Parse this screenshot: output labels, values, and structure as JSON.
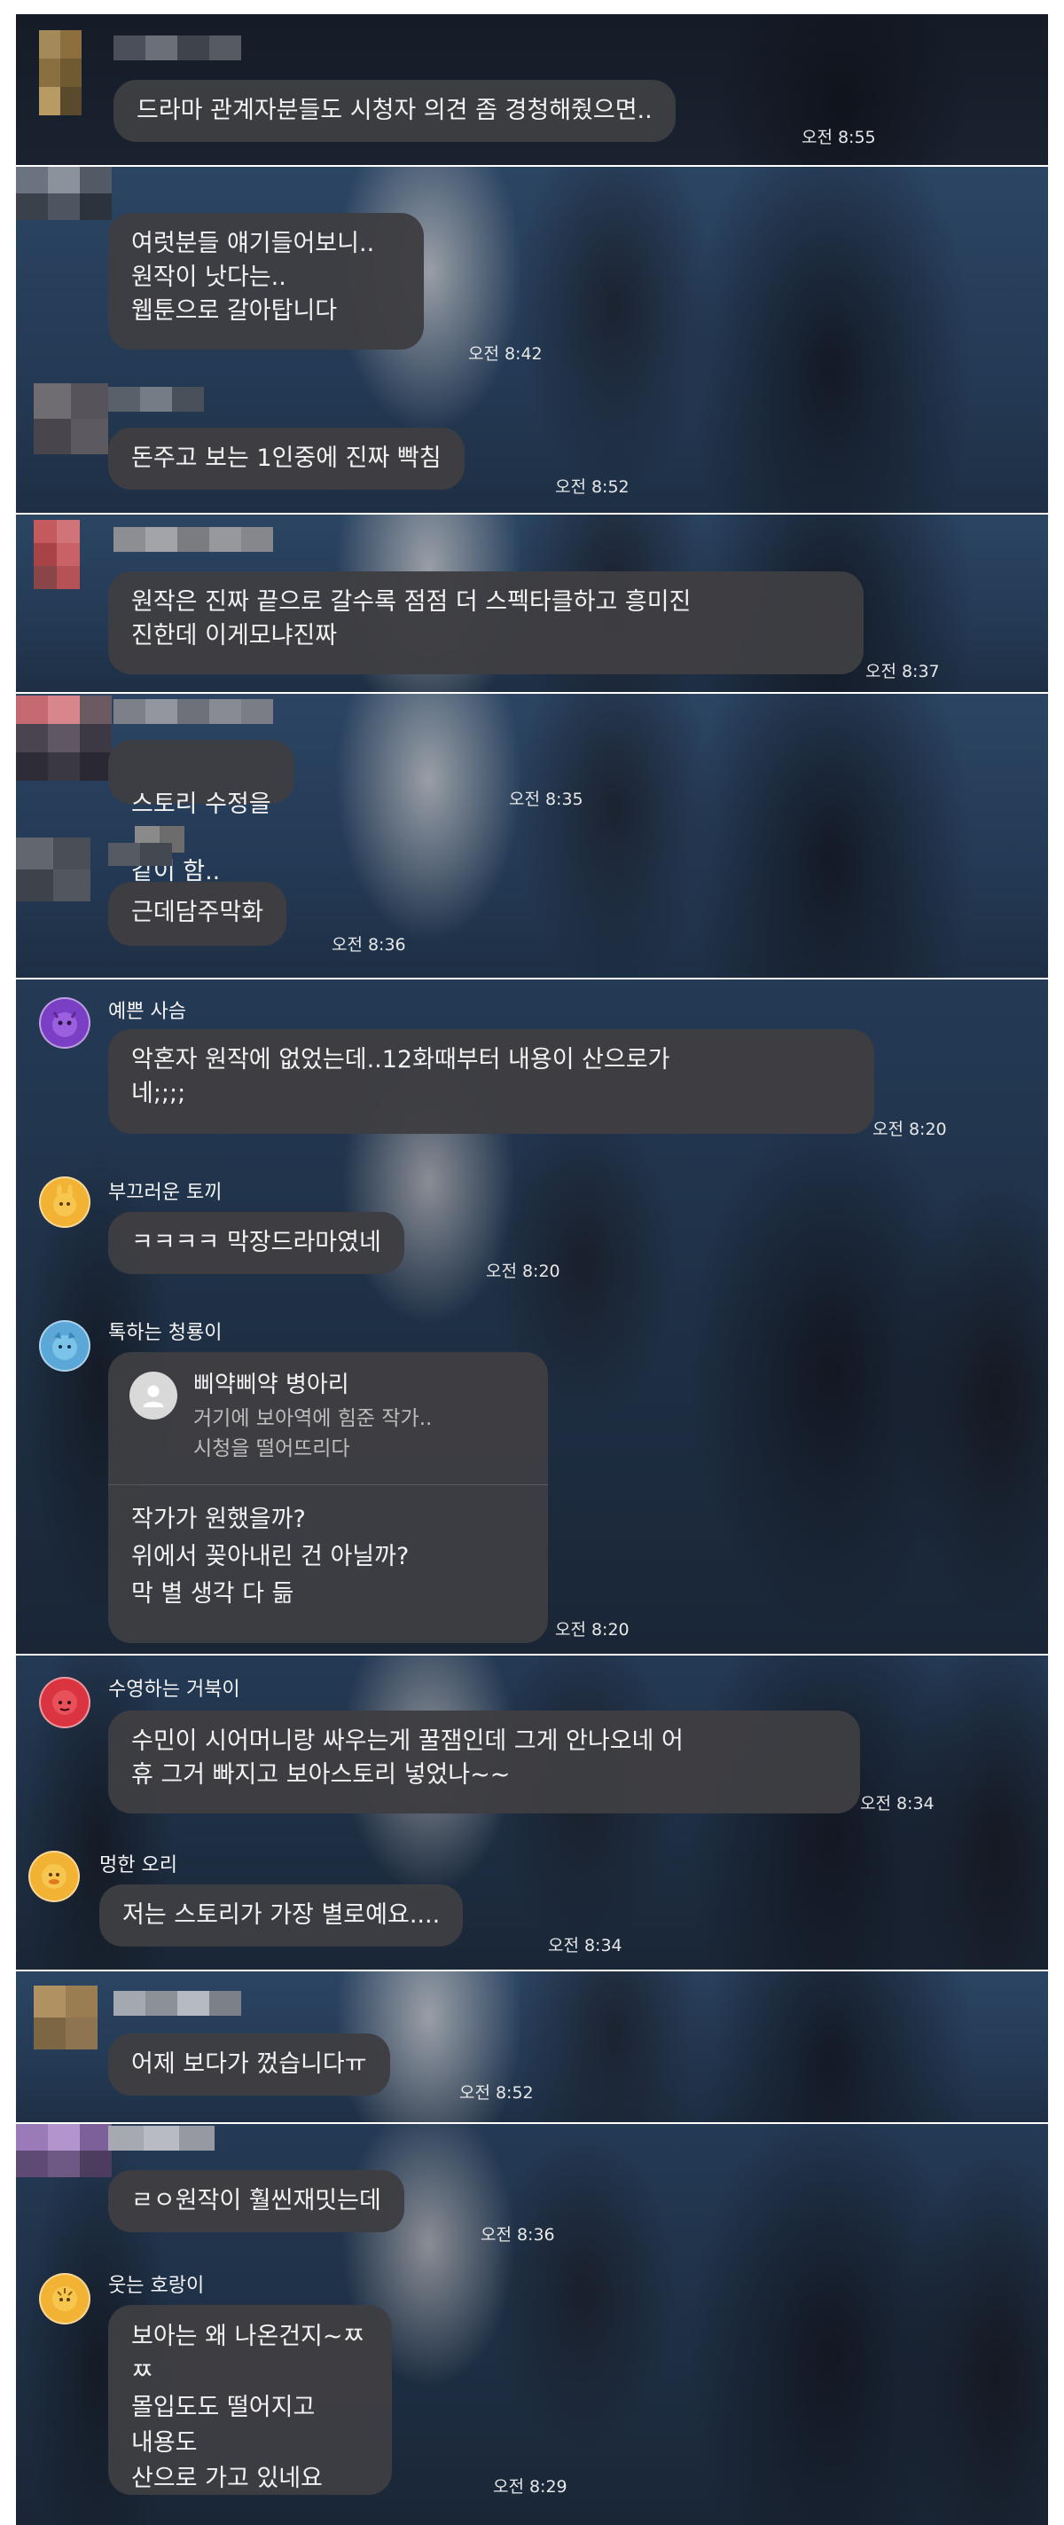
{
  "messages": [
    {
      "text": "드라마 관계자분들도 시청자 의견 좀 경청해줬으면..",
      "ampm": "오전",
      "time": "8:55"
    },
    {
      "text": "여럿분들 얘기들어보니..\n원작이 낫다는..\n웹툰으로 갈아탑니다",
      "ampm": "오전",
      "time": "8:42"
    },
    {
      "text": "돈주고 보는 1인중에 진짜 빡침",
      "ampm": "오전",
      "time": "8:52"
    },
    {
      "text": "원작은 진짜 끝으로 갈수록 점점 더 스펙타클하고 흥미진\n진한데 이게모냐진짜",
      "ampm": "오전",
      "time": "8:37"
    },
    {
      "text_before": "스토리 수정을",
      "text_after": "같이 함..",
      "ampm": "오전",
      "time": "8:35"
    },
    {
      "text": "근데담주막화",
      "ampm": "오전",
      "time": "8:36"
    },
    {
      "nickname": "예쁜 사슴",
      "text": "악혼자 원작에 없었는데..12화때부터 내용이 산으로가\n네;;;;",
      "ampm": "오전",
      "time": "8:20",
      "avatar_color": "#7a3fc4"
    },
    {
      "nickname": "부끄러운 토끼",
      "text": "ㅋㅋㅋㅋ 막장드라마였네",
      "ampm": "오전",
      "time": "8:20",
      "avatar_color": "#f2b233"
    },
    {
      "nickname": "톡하는 청룡이",
      "quote_name": "삐약삐약 병아리",
      "quote_text": "거기에 보아역에 힘준 작가..\n시청을 떨어뜨리다",
      "text": "작가가 원했을까?\n위에서 꽂아내린 건 아닐까?\n막 별 생각 다 듦",
      "ampm": "오전",
      "time": "8:20",
      "avatar_color": "#5aa7d8"
    },
    {
      "nickname": "수영하는 거북이",
      "text": "수민이 시어머니랑 싸우는게 꿀잼인데 그게 안나오네 어\n휴 그거 빠지고 보아스토리 넣었나~~",
      "ampm": "오전",
      "time": "8:34",
      "avatar_color": "#d9343f"
    },
    {
      "nickname": "멍한 오리",
      "text": "저는 스토리가 가장 별로예요....",
      "ampm": "오전",
      "time": "8:34",
      "avatar_color": "#f2b233"
    },
    {
      "text": "어제 보다가 껐습니다ㅠ",
      "ampm": "오전",
      "time": "8:52"
    },
    {
      "text": "ㄹㅇ원작이 훨씬재밋는데",
      "ampm": "오전",
      "time": "8:36"
    },
    {
      "nickname": "웃는 호랑이",
      "text": "보아는 왜 나온건지~ㅉ ㅉ\n몰입도도 떨어지고\n내용도\n산으로 가고 있네요",
      "ampm": "오전",
      "time": "8:29",
      "avatar_color": "#f2b233"
    }
  ]
}
